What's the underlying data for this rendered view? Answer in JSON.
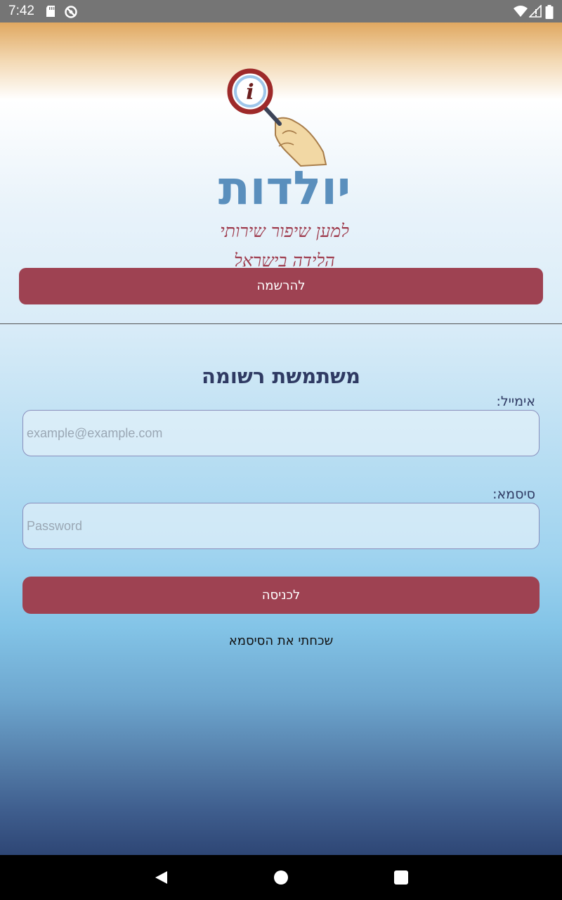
{
  "status_bar": {
    "time": "7:42",
    "icons": [
      "sd-card-icon",
      "no-sync-icon",
      "wifi-icon",
      "signal-icon",
      "battery-icon"
    ]
  },
  "logo": {
    "brand_name": "יולדות",
    "tagline_line1": "למען שיפור שירותי",
    "tagline_line2": "הלידה בישראל",
    "icon": "info-magnifier-icon"
  },
  "register_button": {
    "label": "להרשמה"
  },
  "login_form": {
    "title": "משתמשת רשומה",
    "email_label": "אימייל:",
    "email_placeholder": "example@example.com",
    "email_value": "",
    "password_label": "סיסמא:",
    "password_placeholder": "Password",
    "password_value": "",
    "submit_label": "לכניסה",
    "forgot_password_label": "שכחתי את הסיסמא"
  },
  "navigation_bar": {
    "buttons": [
      "back-icon",
      "home-icon",
      "recents-icon"
    ]
  },
  "colors": {
    "primary_button": "#9e4252",
    "title_text": "#2f3a63",
    "input_border": "#8a8fbd"
  }
}
